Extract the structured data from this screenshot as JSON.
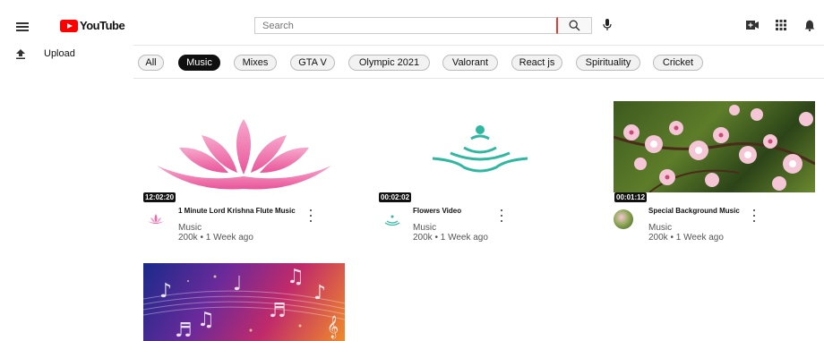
{
  "header": {
    "logo_text": "YouTube",
    "search_placeholder": "Search"
  },
  "sidebar": {
    "upload_label": "Upload"
  },
  "chips": [
    "All",
    "Music",
    "Mixes",
    "GTA V",
    "Olympic 2021",
    "Valorant",
    "React js",
    "Spirituality",
    "Cricket"
  ],
  "active_chip": "Music",
  "videos": [
    {
      "title": "1 Minute Lord Krishna Flute Music",
      "channel": "Music",
      "meta": "200k • 1 Week ago",
      "duration": "12:02:20"
    },
    {
      "title": "Flowers Video",
      "channel": "Music",
      "meta": "200k • 1 Week ago",
      "duration": "00:02:02"
    },
    {
      "title": "Special Background Music",
      "channel": "Music",
      "meta": "200k • 1 Week ago",
      "duration": "00:01:12"
    },
    {
      "title": "",
      "channel": "",
      "meta": "",
      "duration": ""
    }
  ],
  "colors": {
    "brand_red": "#ff0000",
    "lotus_pink": "#f06aa8",
    "teal": "#2fb7a0"
  }
}
